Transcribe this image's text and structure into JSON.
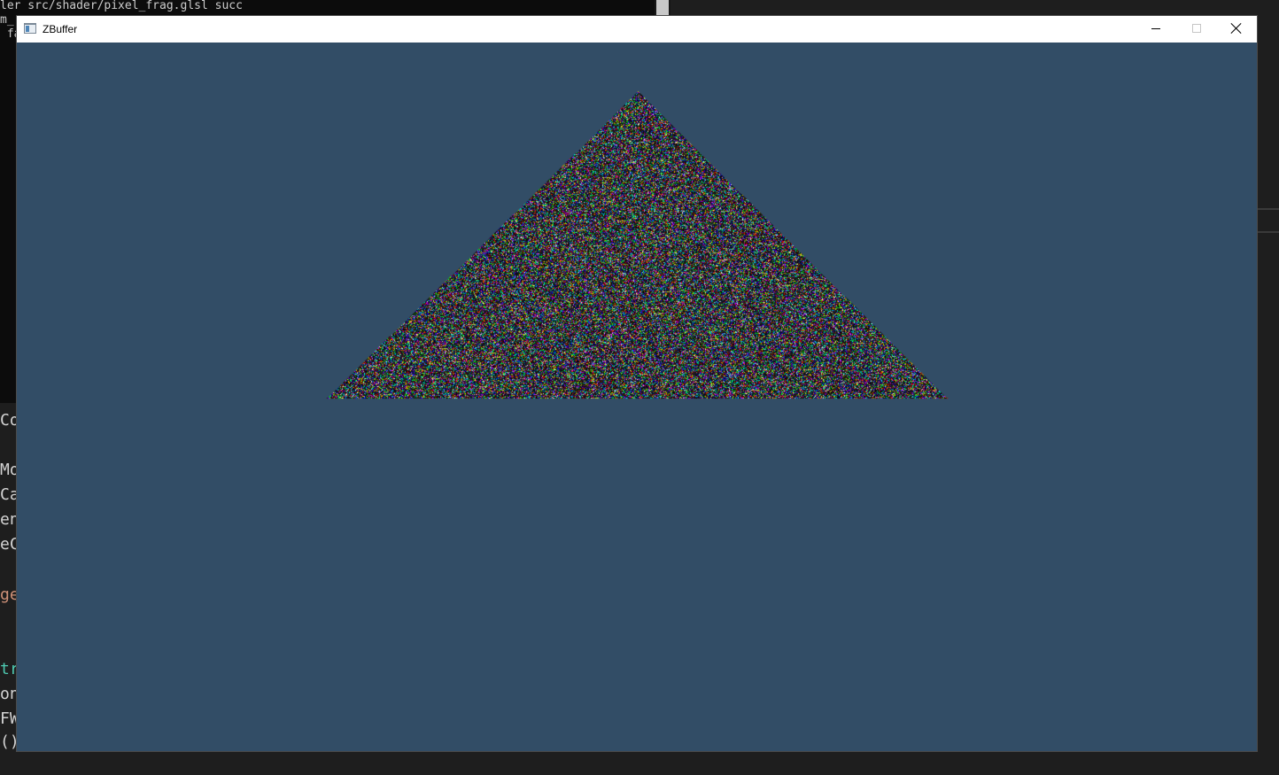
{
  "console": {
    "lines": [
      "ler src/shader/pixel_frag.glsl succ",
      "m_",
      " fa"
    ]
  },
  "editor": {
    "lines": [
      {
        "text": "Co",
        "color": "#d4d4d4"
      },
      {
        "text": "Mo",
        "color": "#d4d4d4"
      },
      {
        "text": "Ca",
        "color": "#d4d4d4"
      },
      {
        "text": "en",
        "color": "#d4d4d4"
      },
      {
        "text": "eC",
        "color": "#d4d4d4"
      },
      {
        "text": "ge",
        "color": "#ce9178"
      },
      {
        "text": "tr",
        "color": "#4ec9b0"
      },
      {
        "text": "on",
        "color": "#d4d4d4"
      },
      {
        "text": "FW",
        "color": "#d4d4d4"
      },
      {
        "text": "()",
        "color": "#d4d4d4"
      }
    ]
  },
  "window": {
    "title": "ZBuffer",
    "background_color": "#324d66",
    "icon": "app-window-icon",
    "buttons": {
      "minimize": "minimize-icon",
      "maximize": "maximize-icon",
      "close": "close-icon"
    }
  },
  "scene": {
    "shape": "triangle",
    "fill": "random-color-noise"
  }
}
